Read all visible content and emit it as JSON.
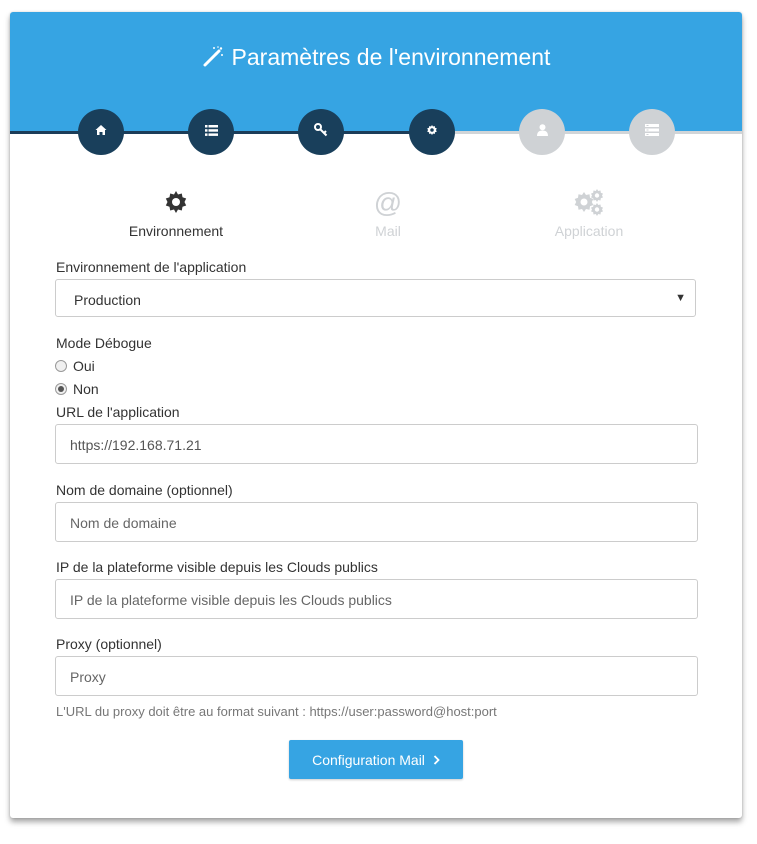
{
  "header": {
    "title": "Paramètres de l'environnement"
  },
  "steps": [
    {
      "icon": "home-icon",
      "state": "done"
    },
    {
      "icon": "list-icon",
      "state": "done"
    },
    {
      "icon": "key-icon",
      "state": "done"
    },
    {
      "icon": "gear-icon",
      "state": "done"
    },
    {
      "icon": "user-icon",
      "state": "todo"
    },
    {
      "icon": "server-icon",
      "state": "todo"
    }
  ],
  "tabs": [
    {
      "label": "Environnement",
      "icon": "gear-icon",
      "active": true
    },
    {
      "label": "Mail",
      "icon": "at-icon",
      "active": false
    },
    {
      "label": "Application",
      "icon": "gears-icon",
      "active": false
    }
  ],
  "form": {
    "env_label": "Environnement de l'application",
    "env_value": "Production",
    "debug_label": "Mode Débogue",
    "debug_options": [
      {
        "label": "Oui",
        "checked": false
      },
      {
        "label": "Non",
        "checked": true
      }
    ],
    "url_label": "URL de l'application",
    "url_value": "https://192.168.71.21",
    "domain_label": "Nom de domaine (optionnel)",
    "domain_placeholder": "Nom de domaine",
    "ip_label": "IP de la plateforme visible depuis les Clouds publics",
    "ip_placeholder": "IP de la plateforme visible depuis les Clouds publics",
    "proxy_label": "Proxy (optionnel)",
    "proxy_placeholder": "Proxy",
    "proxy_help": "L'URL du proxy doit être au format suivant : https://user:password@host:port"
  },
  "button": {
    "label": "Configuration Mail"
  },
  "colors": {
    "primary": "#36a4e3",
    "step_done": "#193f5b",
    "step_todo": "#cfd2d5"
  }
}
